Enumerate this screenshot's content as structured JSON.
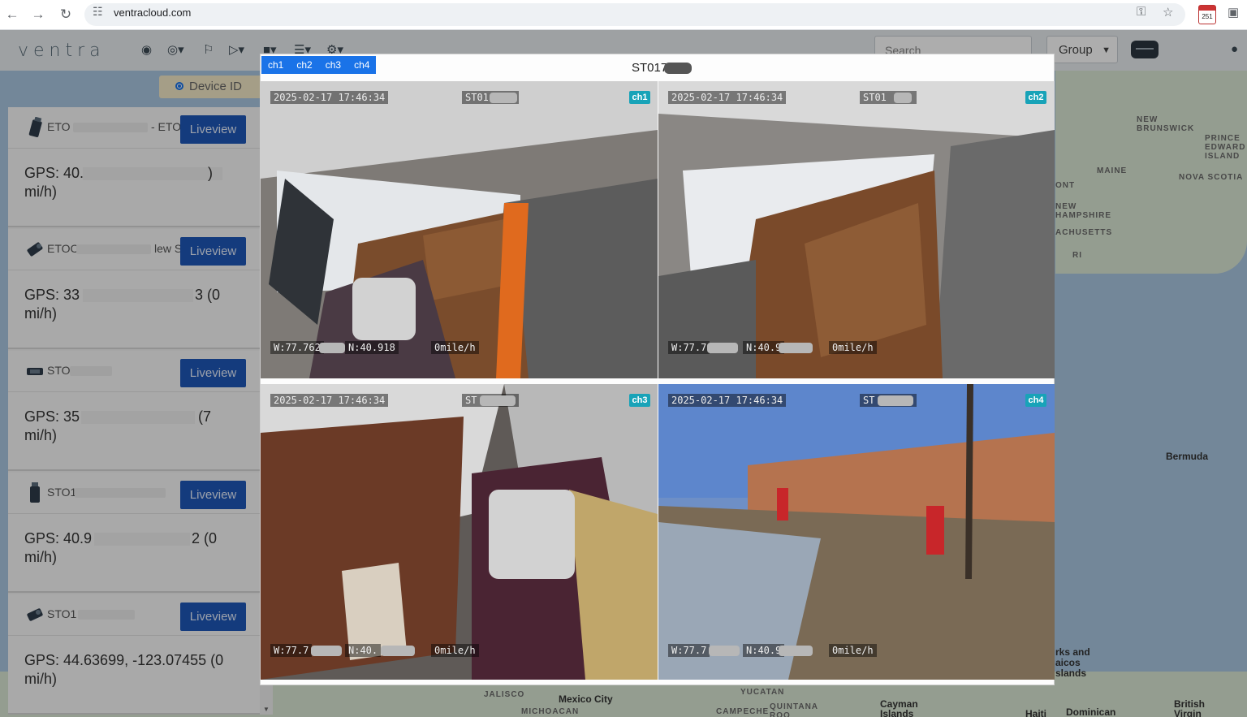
{
  "browser": {
    "url": "ventracloud.com",
    "calendar_badge": "251"
  },
  "app": {
    "logo": "ventra",
    "search_placeholder": "Search",
    "group_label": "Group",
    "radio_label": "Device ID"
  },
  "devices": [
    {
      "name_left": "ETO",
      "name_right": "- ETOOC",
      "button": "Liveview",
      "gps_line1": "GPS: 40.",
      "gps_tail": ")",
      "gps_line2": "mi/h)"
    },
    {
      "name_left": "ETOC",
      "name_right": "lew S",
      "button": "Liveview",
      "gps_line1": "GPS: 33",
      "gps_tail": "3 (0",
      "gps_line2": "mi/h)"
    },
    {
      "name_left": "STO",
      "name_right": "",
      "button": "Liveview",
      "gps_line1": "GPS: 35",
      "gps_tail": "(7",
      "gps_line2": "mi/h)"
    },
    {
      "name_left": "STO1",
      "name_right": "",
      "button": "Liveview",
      "gps_line1": "GPS: 40.9",
      "gps_tail": "2 (0",
      "gps_line2": "mi/h)"
    },
    {
      "name_left": "STO1",
      "name_right": "",
      "button": "Liveview",
      "gps_line1": "GPS: 44.63699, -123.07455 (0",
      "gps_tail": "",
      "gps_line2": "mi/h)"
    }
  ],
  "map_labels": {
    "new_brunswick": "NEW BRUNSWICK",
    "prince_edward": "PRINCE EDWARD ISLAND",
    "maine": "MAINE",
    "nova_scotia": "NOVA SCOTIA",
    "new_hampshire": "NEW HAMPSHIRE",
    "massachusetts": "ACHUSETTS",
    "ri": "RI",
    "ont": "ONT",
    "bermuda": "Bermuda",
    "turks": "rks and aicos slands",
    "jalisco": "JALISCO",
    "mexico_city": "Mexico City",
    "michoacan": "MICHOACAN",
    "yucatan": "YUCATAN",
    "campeche": "CAMPECHE",
    "quintana": "QUINTANA ROO",
    "cayman": "Cayman Islands",
    "haiti": "Haiti",
    "dominican": "Dominican",
    "british": "British Virgin"
  },
  "modal": {
    "title": "ST017",
    "tabs": [
      "ch1",
      "ch2",
      "ch3",
      "ch4"
    ],
    "feeds": [
      {
        "badge": "ch1",
        "timestamp": "2025-02-17 17:46:34",
        "device": "ST01",
        "coord_w": "W:77.762",
        "coord_n": "N:40.918",
        "speed": "0mile/h"
      },
      {
        "badge": "ch2",
        "timestamp": "2025-02-17 17:46:34",
        "device": "ST01",
        "coord_w": "W:77.7",
        "coord_n": "N:40.9",
        "speed": "0mile/h"
      },
      {
        "badge": "ch3",
        "timestamp": "2025-02-17 17:46:34",
        "device": "ST",
        "coord_w": "W:77.7",
        "coord_n": "N:40.",
        "speed": "0mile/h"
      },
      {
        "badge": "ch4",
        "timestamp": "2025-02-17 17:46:34",
        "device": "ST",
        "coord_w": "W:77.7",
        "coord_n": "N:40.9",
        "speed": "0mile/h"
      }
    ]
  }
}
